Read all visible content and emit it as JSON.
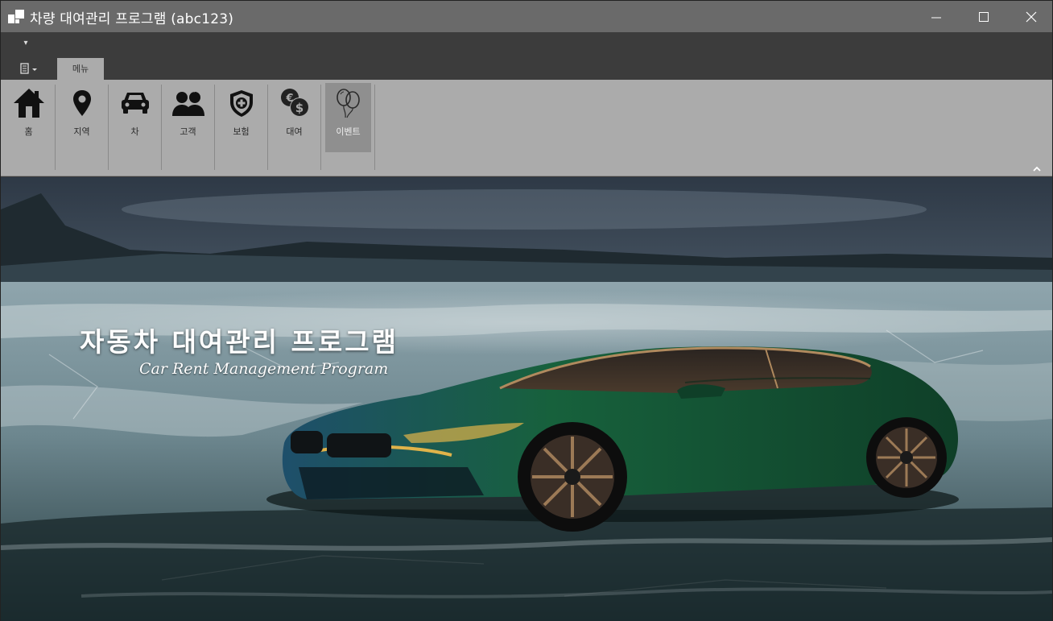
{
  "window": {
    "title": "차량 대여관리 프로그램 (abc123)"
  },
  "quick_access": {
    "icon": "qat-dropdown-icon",
    "glyph": "▾"
  },
  "tabs": [
    {
      "label": "메뉴",
      "selected": true
    }
  ],
  "ribbon": {
    "buttons": [
      {
        "label": "홈",
        "icon": "home-icon"
      },
      {
        "label": "지역",
        "icon": "location-pin-icon"
      },
      {
        "label": "차",
        "icon": "car-icon"
      },
      {
        "label": "고객",
        "icon": "customers-icon"
      },
      {
        "label": "보험",
        "icon": "shield-icon"
      },
      {
        "label": "대여",
        "icon": "currency-icon"
      },
      {
        "label": "이벤트",
        "icon": "balloons-icon",
        "selected": true
      }
    ]
  },
  "banner": {
    "title_ko": "자동차 대여관리 프로그램",
    "title_en": "Car Rent Management Program"
  },
  "colors": {
    "titlebar": "#6a6a6a",
    "ribbon": "#ababab",
    "dark": "#3c3c3c"
  }
}
